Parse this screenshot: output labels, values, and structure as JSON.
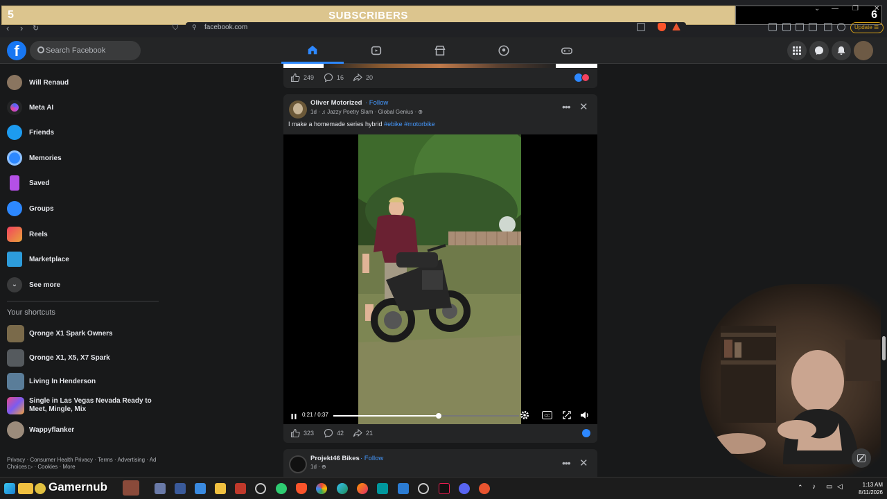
{
  "overlay": {
    "banner_title": "SUBSCRIBERS",
    "left_count": "5",
    "right_count": "6"
  },
  "browser": {
    "url": "facebook.com",
    "update_label": "Update"
  },
  "header": {
    "logo": "f",
    "search_placeholder": "Search Facebook"
  },
  "sidebar": {
    "items": [
      {
        "label": "Will Renaud",
        "icon": "user-avatar",
        "color": "#8a7560"
      },
      {
        "label": "Meta AI",
        "icon": "meta-ai-icon",
        "color": "#8e44ec"
      },
      {
        "label": "Friends",
        "icon": "friends-icon",
        "color": "#1d9bf0"
      },
      {
        "label": "Memories",
        "icon": "clock-icon",
        "color": "#2d88ff"
      },
      {
        "label": "Saved",
        "icon": "bookmark-icon",
        "color": "#b450e6"
      },
      {
        "label": "Groups",
        "icon": "groups-icon",
        "color": "#2d88ff"
      },
      {
        "label": "Reels",
        "icon": "reels-icon",
        "color": "#e64a65"
      },
      {
        "label": "Marketplace",
        "icon": "marketplace-icon",
        "color": "#2d9cdb"
      },
      {
        "label": "See more",
        "icon": "chevron-down-icon",
        "color": "#3a3b3c"
      }
    ],
    "shortcuts_title": "Your shortcuts",
    "shortcuts": [
      {
        "label": "Qronge X1 Spark Owners",
        "color": "#7a6a4a"
      },
      {
        "label": "Qronge X1, X5, X7 Spark",
        "color": "#555a5e"
      },
      {
        "label": "Living In Henderson",
        "color": "#5a7d99"
      },
      {
        "label": "Single in Las Vegas Nevada Ready to Meet, Mingle, Mix",
        "color": "#c44aa8"
      },
      {
        "label": "Wappyflanker",
        "color": "#9b8b7b"
      }
    ],
    "footer": "Privacy · Consumer Health Privacy · Terms · Advertising · Ad Choices ▷ · Cookies · More"
  },
  "feed": {
    "prev_post": {
      "likes": "249",
      "comments": "16",
      "shares": "20"
    },
    "post": {
      "author": "Oliver Motorized",
      "follow": "· Follow",
      "meta": "1d · ♫ Jazzy Poetry Slam · Global Genius ·",
      "text": "I make a homemade series hybrid",
      "tags": "#ebike #motorbike",
      "video": {
        "time": "0:21 / 0:37",
        "progress": 0.5676
      },
      "likes": "323",
      "comments": "42",
      "shares": "21"
    },
    "next_post": {
      "author": "Projekt46 Bikes",
      "follow": "· Follow",
      "meta": "1d ·"
    }
  },
  "taskbar": {
    "streamer": "Gamernub",
    "time": "1:13 AM",
    "date": "8/11/2026"
  },
  "colors": {
    "fb_blue": "#1877f2",
    "link_blue": "#4599ff",
    "banner": "#dcc58e",
    "surface": "#242526",
    "background": "#18191a"
  }
}
